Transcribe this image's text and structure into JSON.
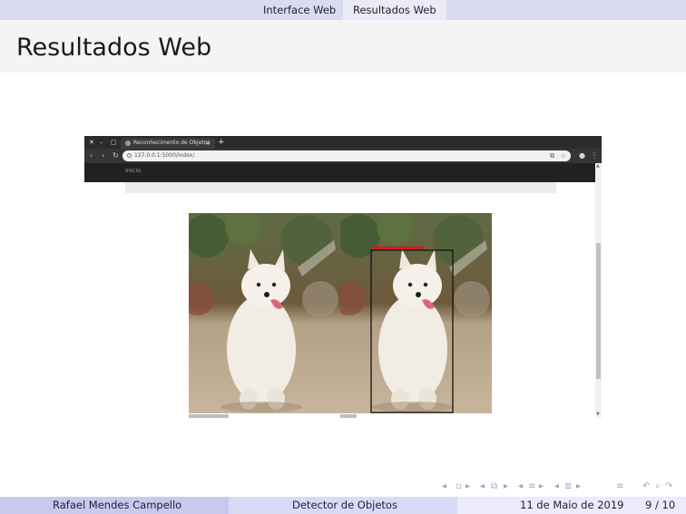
{
  "nav": {
    "sections": [
      {
        "label": "Interface Web",
        "active": false
      },
      {
        "label": "Resultados Web",
        "active": true
      }
    ]
  },
  "slide": {
    "title": "Resultados Web"
  },
  "browser": {
    "tab_title": "Reconhecimento de Objetos",
    "url": "127.0.0.1:5000/index/",
    "page_nav_link": "Início",
    "window_controls": [
      "✕",
      "–",
      "▢"
    ],
    "nav_buttons": [
      "‹",
      "›",
      "↻"
    ],
    "icons": [
      "new-tab-icon",
      "lock-icon",
      "extension-icon",
      "star-icon",
      "account-icon",
      "menu-icon"
    ]
  },
  "results": {
    "left_image": "samoyed-original-photo",
    "right_image": "samoyed-detected-photo",
    "detection_color": "#d01c1c"
  },
  "footer": {
    "author": "Rafael Mendes Campello",
    "presentation_title": "Detector de Objetos",
    "date": "11 de Maio de 2019",
    "page": "9 / 10"
  },
  "theme": {
    "accent": "#c9c9ef",
    "nav_bg": "#dadaf1"
  }
}
